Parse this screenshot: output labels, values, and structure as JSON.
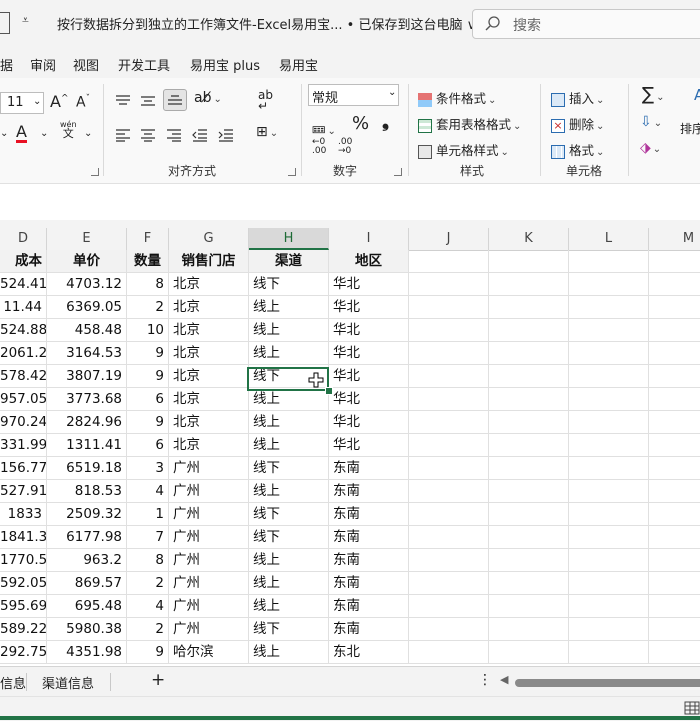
{
  "titlebar": {
    "title": "按行数据拆分到独立的工作簿文件-Excel易用宝...  • 已保存到这台电脑 ∨",
    "qa_dropdown": "⩡"
  },
  "search": {
    "placeholder": "搜索"
  },
  "tabs": [
    "据",
    "审阅",
    "视图",
    "开发工具",
    "易用宝 plus",
    "易用宝"
  ],
  "ribbon": {
    "font_size": "11",
    "grow_font": "A",
    "shrink_font": "A",
    "font_color": "A",
    "wen": "wén",
    "wen2": "文",
    "alignment_label": "对齐方式",
    "number_format": "常规",
    "percent": "%",
    "comma": "❟",
    "number_label": "数字",
    "cond_format": "条件格式",
    "table_format": "套用表格格式",
    "cell_style": "单元格样式",
    "style_label": "样式",
    "insert": "插入",
    "delete": "删除",
    "format": "格式",
    "cells_label": "单元格",
    "sum_sym": "∑",
    "sort_label": "排序"
  },
  "grid": {
    "columns": [
      "D",
      "E",
      "F",
      "G",
      "H",
      "I",
      "J",
      "K",
      "L",
      "M"
    ],
    "headers": [
      "成本",
      "单价",
      "数量",
      "销售门店",
      "渠道",
      "地区"
    ],
    "rows": [
      [
        "524.41",
        "4703.12",
        "8",
        "北京",
        "线下",
        "华北"
      ],
      [
        "11.44",
        "6369.05",
        "2",
        "北京",
        "线上",
        "华北"
      ],
      [
        "524.88",
        "458.48",
        "10",
        "北京",
        "线上",
        "华北"
      ],
      [
        "2061.2",
        "3164.53",
        "9",
        "北京",
        "线上",
        "华北"
      ],
      [
        "578.42",
        "3807.19",
        "9",
        "北京",
        "线下",
        "华北"
      ],
      [
        "957.05",
        "3773.68",
        "6",
        "北京",
        "线上",
        "华北"
      ],
      [
        "970.24",
        "2824.96",
        "9",
        "北京",
        "线上",
        "华北"
      ],
      [
        "331.99",
        "1311.41",
        "6",
        "北京",
        "线上",
        "华北"
      ],
      [
        "156.77",
        "6519.18",
        "3",
        "广州",
        "线下",
        "东南"
      ],
      [
        "527.91",
        "818.53",
        "4",
        "广州",
        "线上",
        "东南"
      ],
      [
        "1833",
        "2509.32",
        "1",
        "广州",
        "线下",
        "东南"
      ],
      [
        "1841.3",
        "6177.98",
        "7",
        "广州",
        "线下",
        "东南"
      ],
      [
        "1770.5",
        "963.2",
        "8",
        "广州",
        "线上",
        "东南"
      ],
      [
        "592.05",
        "869.57",
        "2",
        "广州",
        "线上",
        "东南"
      ],
      [
        "595.69",
        "695.48",
        "4",
        "广州",
        "线上",
        "东南"
      ],
      [
        "589.22",
        "5980.38",
        "2",
        "广州",
        "线下",
        "东南"
      ],
      [
        "292.75",
        "4351.98",
        "9",
        "哈尔滨",
        "线上",
        "东北"
      ]
    ]
  },
  "sheets": [
    "信息",
    "渠道信息",
    "+"
  ],
  "selected_col": "H",
  "colors": {
    "accent": "#217346",
    "font_red": "#e81123"
  }
}
